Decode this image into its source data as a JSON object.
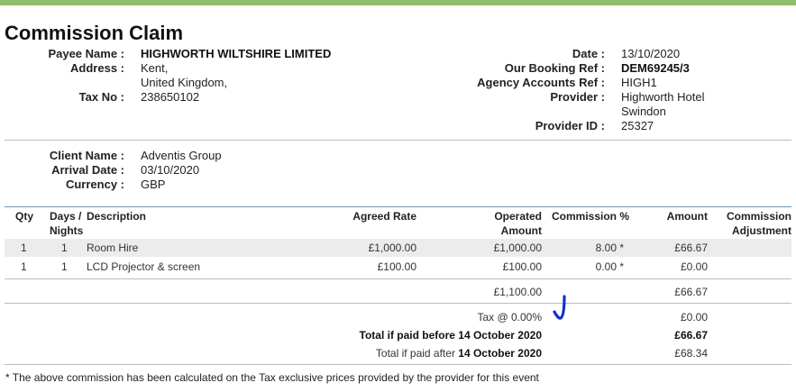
{
  "title": "Commission Claim",
  "payee": {
    "payee_name_label": "Payee Name :",
    "payee_name": "HIGHWORTH WILTSHIRE LIMITED",
    "address_label": "Address :",
    "address_line1": "Kent,",
    "address_line2": "United Kingdom,",
    "tax_label": "Tax No :",
    "tax_no": "238650102"
  },
  "booking": {
    "date_label": "Date :",
    "date": "13/10/2020",
    "our_ref_label": "Our Booking Ref :",
    "our_ref": "DEM69245/3",
    "agency_ref_label": "Agency Accounts Ref :",
    "agency_ref": "HIGH1",
    "provider_label": "Provider :",
    "provider_line1": "Highworth Hotel",
    "provider_line2": "Swindon",
    "provider_id_label": "Provider ID :",
    "provider_id": "25327"
  },
  "client": {
    "client_name_label": "Client Name :",
    "client_name": "Adventis Group",
    "arrival_label": "Arrival Date :",
    "arrival_date": "03/10/2020",
    "currency_label": "Currency :",
    "currency": "GBP"
  },
  "table": {
    "headers": {
      "qty": "Qty",
      "days_1": "Days /",
      "days_2": "Nights",
      "description": "Description",
      "agreed_rate": "Agreed Rate",
      "operated_1": "Operated",
      "operated_2": "Amount",
      "commission_pct": "Commission %",
      "amount": "Amount",
      "adjustment_1": "Commission",
      "adjustment_2": "Adjustment"
    },
    "rows": [
      {
        "qty": "1",
        "days": "1",
        "description": "Room Hire",
        "agreed_rate": "£1,000.00",
        "operated": "£1,000.00",
        "commission_pct": "8.00 *",
        "amount": "£66.67",
        "adjustment": ""
      },
      {
        "qty": "1",
        "days": "1",
        "description": "LCD Projector & screen",
        "agreed_rate": "£100.00",
        "operated": "£100.00",
        "commission_pct": "0.00 *",
        "amount": "£0.00",
        "adjustment": ""
      }
    ]
  },
  "totals": {
    "subtotal_operated": "£1,100.00",
    "subtotal_amount": "£66.67",
    "tax_label": "Tax @ 0.00%",
    "tax_amount": "£0.00",
    "before_prefix": "Total if paid before ",
    "before_date": "14 October 2020",
    "before_amount": "£66.67",
    "after_prefix": "Total if paid after ",
    "after_date": "14 October 2020",
    "after_amount": "£68.34"
  },
  "footnote": "* The above commission has been calculated on the Tax exclusive prices provided by the provider for this event",
  "colors": {
    "top_bar": "#8fbf6a",
    "checkmark": "#1530c8",
    "row_highlight": "#ececec"
  }
}
